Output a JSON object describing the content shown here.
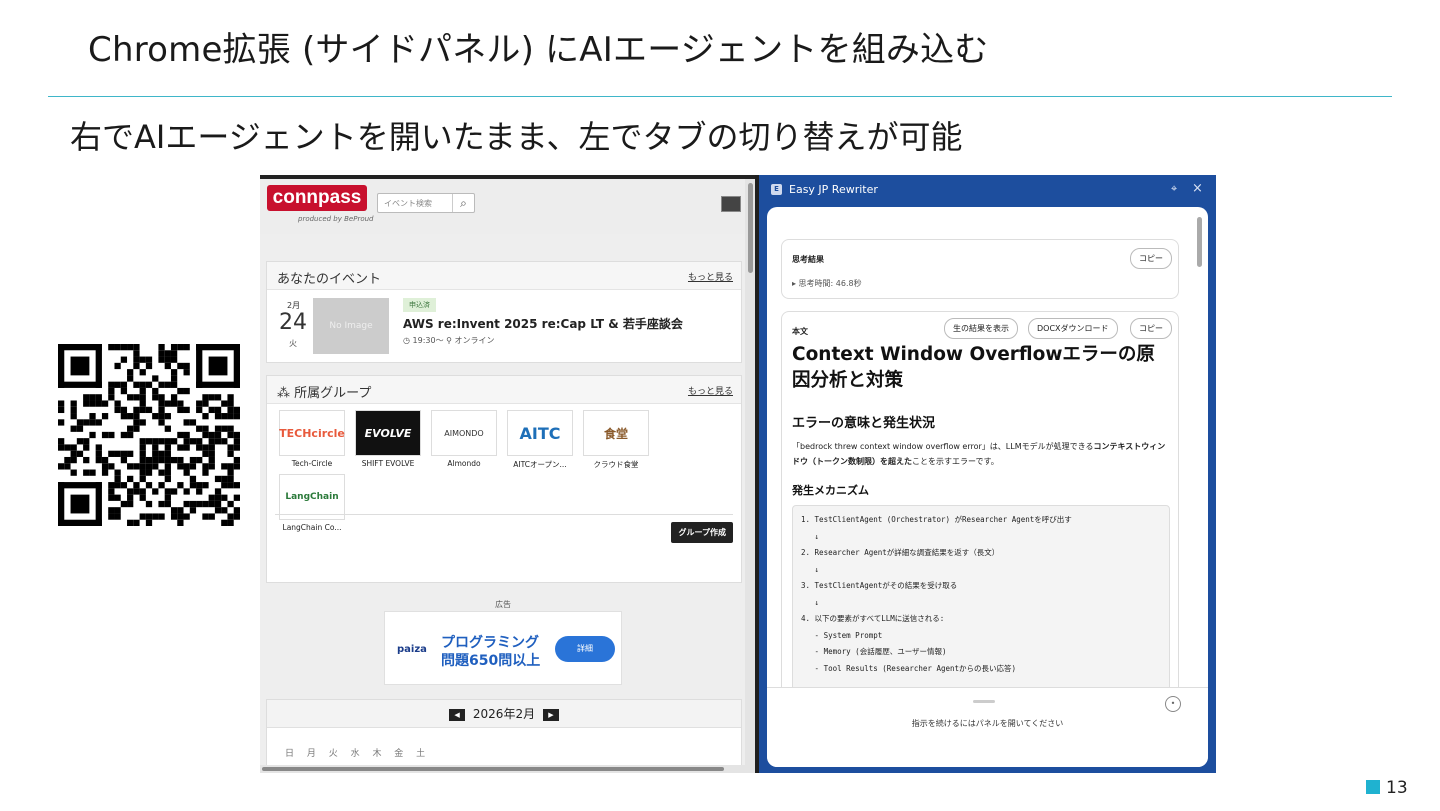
{
  "slide": {
    "title": "Chrome拡張 (サイドパネル) にAIエージェントを組み込む",
    "subtitle": "右でAIエージェントを開いたまま、左でタブの切り替えが可能",
    "page_number": "13"
  },
  "connpass": {
    "logo": "connpass",
    "produced_by": "produced by BeProud",
    "search_placeholder": "イベント検索",
    "your_events": {
      "title": "あなたのイベント",
      "more": "もっと見る",
      "event": {
        "month": "2月",
        "day": "24",
        "weekday": "火",
        "image_placeholder": "No Image",
        "badge": "申込済",
        "title": "AWS re:Invent 2025 re:Cap LT & 若手座談会",
        "time": "19:30〜",
        "location": "オンライン"
      }
    },
    "groups": {
      "title": "所属グループ",
      "more": "もっと見る",
      "items": [
        {
          "name": "Tech-Circle",
          "logo": "TECHcircle"
        },
        {
          "name": "SHIFT EVOLVE",
          "logo": "EVOLVE"
        },
        {
          "name": "Almondo",
          "logo": "AIMONDO"
        },
        {
          "name": "AITCオープン...",
          "logo": "AITC"
        },
        {
          "name": "クラウド食堂",
          "logo": "食堂"
        },
        {
          "name": "LangChain Co...",
          "logo": "LangChain"
        }
      ],
      "create_button": "グループ作成"
    },
    "ad": {
      "label": "広告",
      "brand": "paiza",
      "text": "プログラミング問題650問以上",
      "button": "詳細"
    },
    "calendar": {
      "month": "2026年2月",
      "weekdays": "日 月 火 水 木 金 土"
    }
  },
  "side_panel": {
    "icon": "E",
    "title": "Easy JP Rewriter",
    "result": {
      "label": "思考結果",
      "copy": "コピー",
      "time": "▸ 思考時間: 46.8秒"
    },
    "body": {
      "label": "本文",
      "show_raw": "生の結果を表示",
      "docx": "DOCXダウンロード",
      "copy": "コピー",
      "h1": "Context Window Overflowエラーの原因分析と対策",
      "h2": "エラーの意味と発生状況",
      "p_plain": "「bedrock threw context window overflow error」は、LLMモデルが処理できる",
      "p_bold": "コンテキストウィンドウ（トークン数制限）を超えた",
      "p_tail": "ことを示すエラーです。",
      "h3": "発生メカニズム",
      "code": "1. TestClientAgent (Orchestrator) がResearcher Agentを呼び出す\n   ↓\n2. Researcher Agentが詳細な調査結果を返す（長文）\n   ↓\n3. TestClientAgentがその結果を受け取る\n   ↓\n4. 以下の要素がすべてLLMに送信される:\n   - System Prompt\n   - Memory (会話履歴、ユーザー情報)\n   - Tool Results (Researcher Agentからの長い応答)"
    },
    "footer_prompt": "指示を続けるにはパネルを開いてください"
  }
}
